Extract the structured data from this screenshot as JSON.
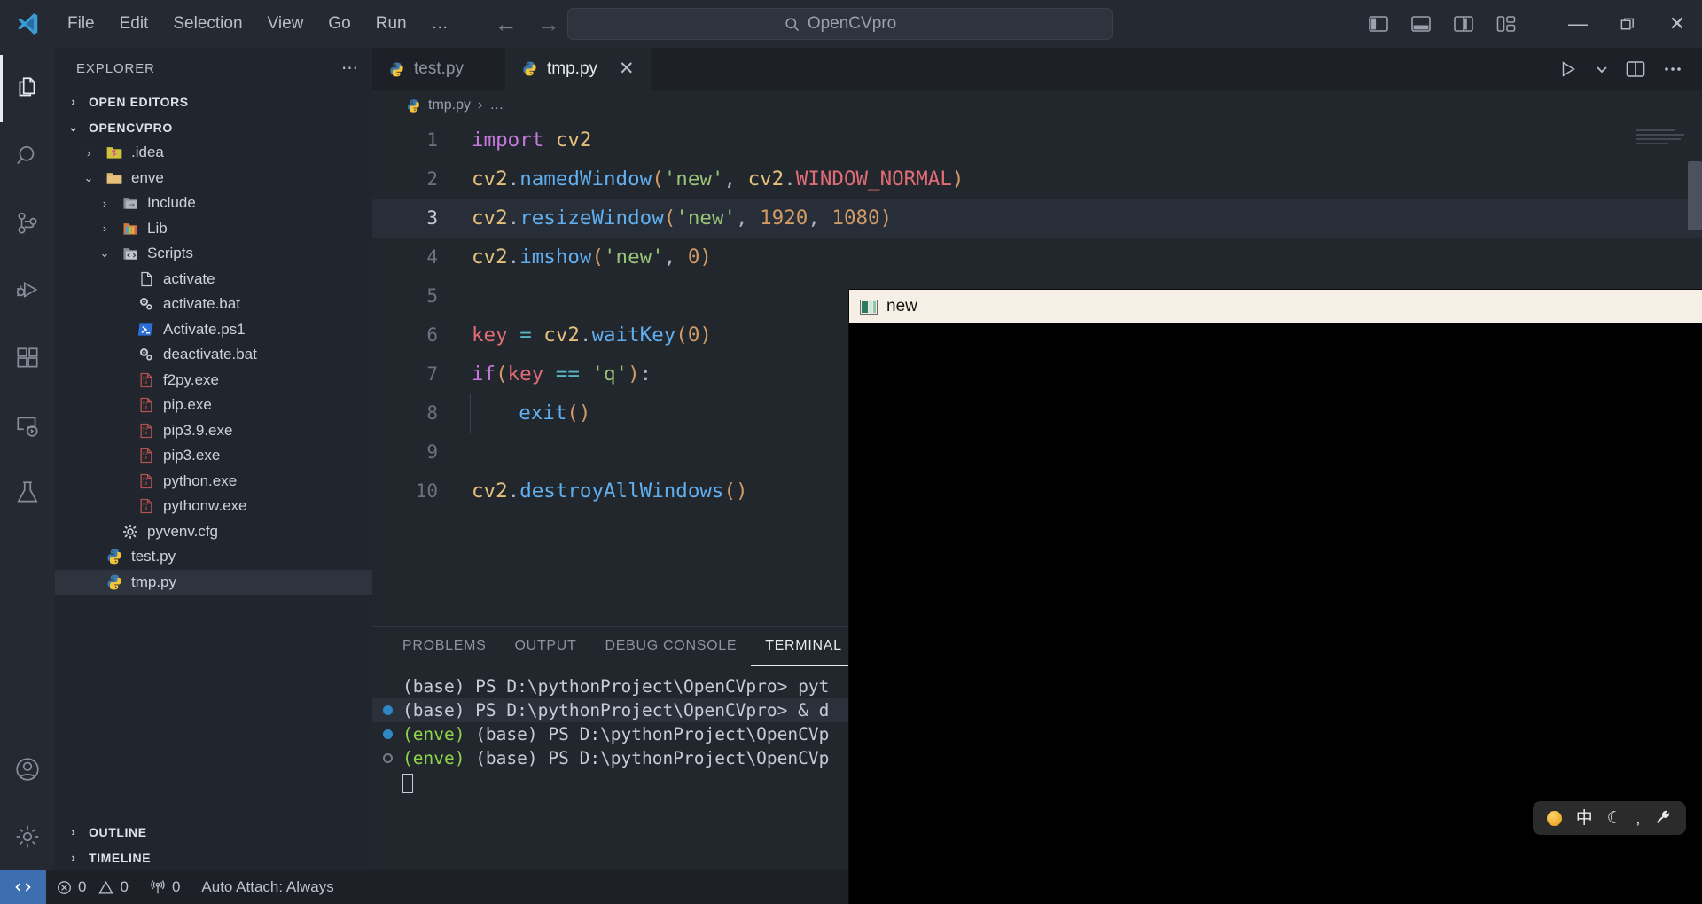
{
  "titlebar": {
    "logo_name": "vscode-logo",
    "menu": [
      {
        "label": "File"
      },
      {
        "label": "Edit"
      },
      {
        "label": "Selection"
      },
      {
        "label": "View"
      },
      {
        "label": "Go"
      },
      {
        "label": "Run"
      },
      {
        "label": "…"
      }
    ],
    "nav": {
      "back": "←",
      "forward": "→"
    },
    "search": {
      "icon": "search-icon",
      "text": "OpenCVpro"
    },
    "layout_icons": [
      "toggle-primary-sidebar-icon",
      "toggle-panel-icon",
      "toggle-secondary-sidebar-icon",
      "customize-layout-icon"
    ],
    "window_controls": {
      "minimize": "—",
      "restore": "❐",
      "close": "✕"
    }
  },
  "activitybar": {
    "items": [
      {
        "name": "explorer",
        "icon": "files-icon",
        "active": true
      },
      {
        "name": "search",
        "icon": "search-icon",
        "active": false
      },
      {
        "name": "source-control",
        "icon": "source-control-icon",
        "active": false
      },
      {
        "name": "run-and-debug",
        "icon": "run-debug-icon",
        "active": false
      },
      {
        "name": "extensions",
        "icon": "extensions-icon",
        "active": false
      },
      {
        "name": "remote-explorer",
        "icon": "remote-explorer-icon",
        "active": false
      },
      {
        "name": "testing",
        "icon": "beaker-icon",
        "active": false
      }
    ],
    "bottom": [
      {
        "name": "accounts",
        "icon": "account-icon"
      },
      {
        "name": "manage",
        "icon": "gear-icon"
      }
    ]
  },
  "sidebar": {
    "title": "EXPLORER",
    "more_actions": "⋯",
    "sections": [
      {
        "label": "OPEN EDITORS",
        "expanded": false,
        "chevron": "›"
      },
      {
        "label": "OPENCVPRO",
        "expanded": true,
        "chevron": "⌄"
      }
    ],
    "tree": [
      {
        "label": ".idea",
        "indent": 1,
        "twisty": "›",
        "icon": "folder-idea-icon",
        "selected": false
      },
      {
        "label": "enve",
        "indent": 1,
        "twisty": "⌄",
        "icon": "folder-open-icon",
        "selected": false
      },
      {
        "label": "Include",
        "indent": 2,
        "twisty": "›",
        "icon": "folder-include-icon",
        "selected": false
      },
      {
        "label": "Lib",
        "indent": 2,
        "twisty": "›",
        "icon": "folder-lib-icon",
        "selected": false
      },
      {
        "label": "Scripts",
        "indent": 2,
        "twisty": "⌄",
        "icon": "folder-scripts-icon",
        "selected": false
      },
      {
        "label": "activate",
        "indent": 3,
        "twisty": "",
        "icon": "file-plain-icon",
        "selected": false
      },
      {
        "label": "activate.bat",
        "indent": 3,
        "twisty": "",
        "icon": "file-bat-icon",
        "selected": false
      },
      {
        "label": "Activate.ps1",
        "indent": 3,
        "twisty": "",
        "icon": "file-powershell-icon",
        "selected": false
      },
      {
        "label": "deactivate.bat",
        "indent": 3,
        "twisty": "",
        "icon": "file-bat-icon",
        "selected": false
      },
      {
        "label": "f2py.exe",
        "indent": 3,
        "twisty": "",
        "icon": "file-binary-icon",
        "selected": false
      },
      {
        "label": "pip.exe",
        "indent": 3,
        "twisty": "",
        "icon": "file-binary-icon",
        "selected": false
      },
      {
        "label": "pip3.9.exe",
        "indent": 3,
        "twisty": "",
        "icon": "file-binary-icon",
        "selected": false
      },
      {
        "label": "pip3.exe",
        "indent": 3,
        "twisty": "",
        "icon": "file-binary-icon",
        "selected": false
      },
      {
        "label": "python.exe",
        "indent": 3,
        "twisty": "",
        "icon": "file-binary-icon",
        "selected": false
      },
      {
        "label": "pythonw.exe",
        "indent": 3,
        "twisty": "",
        "icon": "file-binary-icon",
        "selected": false
      },
      {
        "label": "pyvenv.cfg",
        "indent": 2,
        "twisty": "",
        "icon": "file-config-icon",
        "selected": false
      },
      {
        "label": "test.py",
        "indent": 1,
        "twisty": "",
        "icon": "file-python-icon",
        "selected": false
      },
      {
        "label": "tmp.py",
        "indent": 1,
        "twisty": "",
        "icon": "file-python-icon",
        "selected": true
      }
    ],
    "footer": [
      {
        "label": "OUTLINE",
        "chevron": "›"
      },
      {
        "label": "TIMELINE",
        "chevron": "›"
      }
    ]
  },
  "editor": {
    "tabs": [
      {
        "label": "test.py",
        "icon": "file-python-icon",
        "active": false,
        "closable": false
      },
      {
        "label": "tmp.py",
        "icon": "file-python-icon",
        "active": true,
        "closable": true,
        "close": "✕"
      }
    ],
    "tab_actions": [
      "run-icon",
      "run-dropdown-icon",
      "split-editor-icon",
      "more-actions-icon"
    ],
    "breadcrumb": {
      "icon": "file-python-icon",
      "file": "tmp.py",
      "sep": "›",
      "rest": "…"
    },
    "lines": [
      {
        "num": "1",
        "highlight": false,
        "indent": false,
        "tokens": [
          {
            "t": "import",
            "c": "t-kw"
          },
          {
            "t": " ",
            "c": "t-plain"
          },
          {
            "t": "cv2",
            "c": "t-mod"
          }
        ]
      },
      {
        "num": "2",
        "highlight": false,
        "indent": false,
        "tokens": [
          {
            "t": "cv2",
            "c": "t-mod"
          },
          {
            "t": ".",
            "c": "t-plain"
          },
          {
            "t": "namedWindow",
            "c": "t-fn"
          },
          {
            "t": "(",
            "c": "t-punc"
          },
          {
            "t": "'new'",
            "c": "t-str"
          },
          {
            "t": ",",
            "c": "t-plain"
          },
          {
            "t": " ",
            "c": "t-plain"
          },
          {
            "t": "cv2",
            "c": "t-mod"
          },
          {
            "t": ".",
            "c": "t-plain"
          },
          {
            "t": "WINDOW_NORMAL",
            "c": "t-const"
          },
          {
            "t": ")",
            "c": "t-punc"
          }
        ]
      },
      {
        "num": "3",
        "highlight": true,
        "indent": false,
        "tokens": [
          {
            "t": "cv2",
            "c": "t-mod"
          },
          {
            "t": ".",
            "c": "t-plain"
          },
          {
            "t": "resizeWindow",
            "c": "t-fn"
          },
          {
            "t": "(",
            "c": "t-punc"
          },
          {
            "t": "'new'",
            "c": "t-str"
          },
          {
            "t": ",",
            "c": "t-plain"
          },
          {
            "t": " ",
            "c": "t-plain"
          },
          {
            "t": "1920",
            "c": "t-num"
          },
          {
            "t": ",",
            "c": "t-plain"
          },
          {
            "t": " ",
            "c": "t-plain"
          },
          {
            "t": "1080",
            "c": "t-num"
          },
          {
            "t": ")",
            "c": "t-punc"
          }
        ]
      },
      {
        "num": "4",
        "highlight": false,
        "indent": false,
        "tokens": [
          {
            "t": "cv2",
            "c": "t-mod"
          },
          {
            "t": ".",
            "c": "t-plain"
          },
          {
            "t": "imshow",
            "c": "t-fn"
          },
          {
            "t": "(",
            "c": "t-punc"
          },
          {
            "t": "'new'",
            "c": "t-str"
          },
          {
            "t": ",",
            "c": "t-plain"
          },
          {
            "t": " ",
            "c": "t-plain"
          },
          {
            "t": "0",
            "c": "t-num"
          },
          {
            "t": ")",
            "c": "t-punc"
          }
        ]
      },
      {
        "num": "5",
        "highlight": false,
        "indent": false,
        "tokens": []
      },
      {
        "num": "6",
        "highlight": false,
        "indent": false,
        "tokens": [
          {
            "t": "key",
            "c": "t-var"
          },
          {
            "t": " ",
            "c": "t-plain"
          },
          {
            "t": "=",
            "c": "t-op"
          },
          {
            "t": " ",
            "c": "t-plain"
          },
          {
            "t": "cv2",
            "c": "t-mod"
          },
          {
            "t": ".",
            "c": "t-plain"
          },
          {
            "t": "waitKey",
            "c": "t-fn"
          },
          {
            "t": "(",
            "c": "t-punc"
          },
          {
            "t": "0",
            "c": "t-num"
          },
          {
            "t": ")",
            "c": "t-punc"
          }
        ]
      },
      {
        "num": "7",
        "highlight": false,
        "indent": false,
        "tokens": [
          {
            "t": "if",
            "c": "t-kw"
          },
          {
            "t": "(",
            "c": "t-punc"
          },
          {
            "t": "key",
            "c": "t-var"
          },
          {
            "t": " ",
            "c": "t-plain"
          },
          {
            "t": "==",
            "c": "t-op"
          },
          {
            "t": " ",
            "c": "t-plain"
          },
          {
            "t": "'q'",
            "c": "t-str"
          },
          {
            "t": ")",
            "c": "t-punc"
          },
          {
            "t": ":",
            "c": "t-plain"
          }
        ]
      },
      {
        "num": "8",
        "highlight": false,
        "indent": true,
        "tokens": [
          {
            "t": "    ",
            "c": "t-plain"
          },
          {
            "t": "exit",
            "c": "t-fn"
          },
          {
            "t": "(",
            "c": "t-punc"
          },
          {
            "t": ")",
            "c": "t-punc"
          }
        ]
      },
      {
        "num": "9",
        "highlight": false,
        "indent": false,
        "tokens": []
      },
      {
        "num": "10",
        "highlight": false,
        "indent": false,
        "tokens": [
          {
            "t": "cv2",
            "c": "t-mod"
          },
          {
            "t": ".",
            "c": "t-plain"
          },
          {
            "t": "destroyAllWindows",
            "c": "t-fn"
          },
          {
            "t": "(",
            "c": "t-punc"
          },
          {
            "t": ")",
            "c": "t-punc"
          }
        ]
      }
    ]
  },
  "panel": {
    "tabs": [
      {
        "label": "PROBLEMS",
        "active": false
      },
      {
        "label": "OUTPUT",
        "active": false
      },
      {
        "label": "DEBUG CONSOLE",
        "active": false
      },
      {
        "label": "TERMINAL",
        "active": true
      }
    ],
    "terminal_lines": [
      {
        "marker": "none",
        "segments": [
          {
            "t": "(base) PS D:\\pythonProject\\OpenCVpro> pyt",
            "c": "tt"
          }
        ],
        "highlight": false
      },
      {
        "marker": "filled",
        "segments": [
          {
            "t": "(base) PS D:\\pythonProject\\OpenCVpro> & d",
            "c": "tt"
          }
        ],
        "highlight": true
      },
      {
        "marker": "filled",
        "segments": [
          {
            "t": "(enve) ",
            "c": "t-green"
          },
          {
            "t": "(base) PS D:\\pythonProject\\OpenCVp",
            "c": "tt"
          }
        ],
        "highlight": false
      },
      {
        "marker": "hollow",
        "segments": [
          {
            "t": "(enve) ",
            "c": "t-green"
          },
          {
            "t": "(base) PS D:\\pythonProject\\OpenCVp",
            "c": "tt"
          }
        ],
        "highlight": false
      },
      {
        "marker": "none",
        "segments": [],
        "cursor": true,
        "highlight": false
      }
    ]
  },
  "statusbar": {
    "remote_icon": "remote-window-icon",
    "items": [
      {
        "name": "errors",
        "icon": "error-icon",
        "value": "0"
      },
      {
        "name": "warnings",
        "icon": "warning-icon",
        "value": "0"
      },
      {
        "name": "ports",
        "icon": "radio-tower-icon",
        "value": "0"
      },
      {
        "name": "auto-attach",
        "icon": "",
        "value": "Auto Attach: Always"
      }
    ]
  },
  "cv_window": {
    "title": "new",
    "icon": "opencv-window-icon",
    "canvas_color": "#000000"
  },
  "ime_tray": {
    "items": [
      {
        "name": "ime-status-dot",
        "glyph": ""
      },
      {
        "name": "ime-chinese-mode",
        "glyph": "中"
      },
      {
        "name": "ime-moon",
        "glyph": "☾"
      },
      {
        "name": "ime-punctuation",
        "glyph": "‚"
      },
      {
        "name": "ime-settings-wrench",
        "glyph": "🔧"
      }
    ]
  }
}
